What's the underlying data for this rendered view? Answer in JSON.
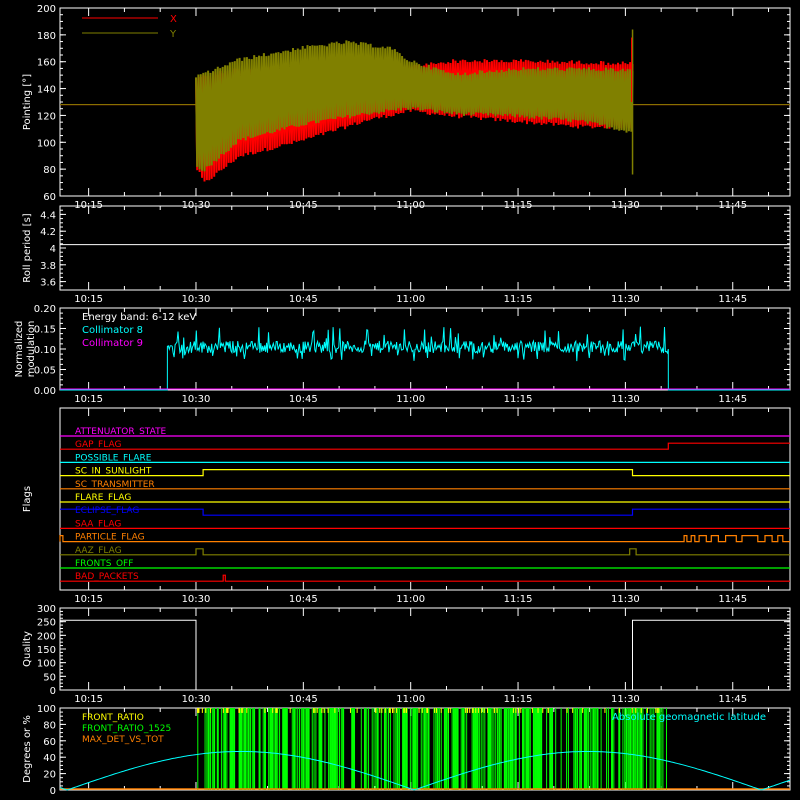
{
  "chart_data": [
    {
      "id": "pointing",
      "type": "line",
      "ylabel": "Pointing [°]",
      "ylim": [
        60,
        200
      ],
      "yticks": [
        60,
        80,
        100,
        120,
        140,
        160,
        180,
        200
      ],
      "xlim": [
        "10:11",
        "11:53"
      ],
      "xticks": [
        "10:15",
        "10:30",
        "10:45",
        "11:00",
        "11:15",
        "11:30",
        "11:45"
      ],
      "legend_position": "top-left",
      "series": [
        {
          "name": "X",
          "color": "#ff0000",
          "baseline": 128,
          "active_range": [
            "10:30",
            "11:31"
          ],
          "upper_envelope": [
            [
              10.5,
              150
            ],
            [
              10.6,
              156
            ],
            [
              10.75,
              158
            ],
            [
              10.9,
              156
            ],
            [
              11.0,
              158
            ],
            [
              11.1,
              162
            ],
            [
              11.25,
              162
            ],
            [
              11.4,
              161
            ],
            [
              11.52,
              160
            ]
          ],
          "lower_envelope": [
            [
              10.5,
              80
            ],
            [
              10.52,
              68
            ],
            [
              10.6,
              88
            ],
            [
              10.75,
              100
            ],
            [
              10.9,
              115
            ],
            [
              11.0,
              122
            ],
            [
              11.1,
              118
            ],
            [
              11.25,
              114
            ],
            [
              11.4,
              110
            ],
            [
              11.52,
              110
            ]
          ]
        },
        {
          "name": "Y",
          "color": "#808000",
          "baseline": 128,
          "active_range": [
            "10:30",
            "11:31"
          ],
          "upper_envelope": [
            [
              10.5,
              150
            ],
            [
              10.6,
              163
            ],
            [
              10.75,
              172
            ],
            [
              10.85,
              176
            ],
            [
              10.95,
              172
            ],
            [
              11.0,
              162
            ],
            [
              11.1,
              152
            ],
            [
              11.25,
              156
            ],
            [
              11.4,
              156
            ],
            [
              11.52,
              155
            ]
          ],
          "lower_envelope": [
            [
              10.5,
              80
            ],
            [
              10.52,
              78
            ],
            [
              10.6,
              100
            ],
            [
              10.75,
              112
            ],
            [
              10.9,
              120
            ],
            [
              11.0,
              124
            ],
            [
              11.1,
              120
            ],
            [
              11.25,
              118
            ],
            [
              11.4,
              114
            ],
            [
              11.52,
              106
            ]
          ]
        }
      ]
    },
    {
      "id": "roll-period",
      "type": "line",
      "ylabel": "Roll period [s]",
      "ylim": [
        3.5,
        4.5
      ],
      "yticks": [
        3.6,
        3.8,
        4.0,
        4.2,
        4.4
      ],
      "xticks": [
        "10:15",
        "10:30",
        "10:45",
        "11:00",
        "11:15",
        "11:30",
        "11:45"
      ],
      "series": [
        {
          "name": "",
          "color": "#ffffff",
          "value": 4.04
        }
      ]
    },
    {
      "id": "modulation",
      "type": "line",
      "ylabel": "Normalized modulation",
      "ylim": [
        0,
        0.2
      ],
      "yticks": [
        "0.00",
        "0.05",
        "0.10",
        "0.15",
        "0.20"
      ],
      "xticks": [
        "10:15",
        "10:30",
        "10:45",
        "11:00",
        "11:15",
        "11:30",
        "11:45"
      ],
      "annotation": "Energy band: 6-12 keV",
      "series": [
        {
          "name": "Collimator 8",
          "color": "#00ffff",
          "active_range": [
            "10:26",
            "11:36"
          ],
          "mean": 0.105,
          "spread": 0.015
        },
        {
          "name": "Collimator 9",
          "color": "#ff00ff",
          "value": 0.0
        }
      ]
    },
    {
      "id": "flags",
      "type": "line",
      "ylabel": "Flags",
      "xticks": [
        "10:15",
        "10:30",
        "10:45",
        "11:00",
        "11:15",
        "11:30",
        "11:45"
      ],
      "flags": [
        {
          "label": "ATTENUATOR_STATE",
          "color": "#ff00ff",
          "transitions": []
        },
        {
          "label": "GAP_FLAG",
          "color": "#ff0000",
          "transitions": [
            [
              "11:36",
              1
            ]
          ]
        },
        {
          "label": "POSSIBLE_FLARE",
          "color": "#00ffff",
          "transitions": []
        },
        {
          "label": "SC_IN_SUNLIGHT",
          "color": "#ffff00",
          "transitions": [
            [
              "10:31",
              1
            ],
            [
              "11:31",
              0
            ]
          ]
        },
        {
          "label": "SC_TRANSMITTER",
          "color": "#ff8000",
          "transitions": []
        },
        {
          "label": "FLARE_FLAG",
          "color": "#ffff00",
          "transitions": []
        },
        {
          "label": "ECLIPSE_FLAG",
          "color": "#0000ff",
          "initial": 1,
          "transitions": [
            [
              "10:31",
              0
            ],
            [
              "11:31",
              1
            ]
          ]
        },
        {
          "label": "SAA_FLAG",
          "color": "#ff0000",
          "transitions": []
        },
        {
          "label": "PARTICLE_FLAG",
          "color": "#ff8000",
          "pulses": [
            [
              "10:11",
              "10:11.4"
            ],
            [
              "11:38.2",
              "11:38.6"
            ],
            [
              "11:39.2",
              "11:39.7"
            ],
            [
              "11:40.3",
              "11:41.3"
            ],
            [
              "11:42",
              "11:43"
            ],
            [
              "11:44",
              "11:45.5"
            ],
            [
              "11:46.3",
              "11:48.5"
            ],
            [
              "11:49.5",
              "11:50.5"
            ],
            [
              "11:51.3",
              "11:52"
            ]
          ]
        },
        {
          "label": "AAZ_FLAG",
          "color": "#808000",
          "pulses": [
            [
              "10:30",
              "10:31"
            ],
            [
              "11:30.6",
              "11:31.5"
            ]
          ]
        },
        {
          "label": "FRONTS_OFF",
          "color": "#00ff00",
          "transitions": []
        },
        {
          "label": "BAD_PACKETS",
          "color": "#ff0000",
          "pulses": [
            [
              "10:33.8",
              "10:34.1"
            ]
          ]
        }
      ]
    },
    {
      "id": "quality",
      "type": "line",
      "ylabel": "Quality",
      "ylim": [
        0,
        300
      ],
      "yticks": [
        0,
        50,
        100,
        150,
        200,
        250,
        300
      ],
      "xticks": [
        "10:15",
        "10:30",
        "10:45",
        "11:00",
        "11:15",
        "11:30",
        "11:45"
      ],
      "series": [
        {
          "name": "",
          "color": "#ffffff",
          "steps": [
            [
              "10:11",
              255
            ],
            [
              "10:30",
              0
            ],
            [
              "11:31",
              255
            ],
            [
              "11:53",
              255
            ]
          ]
        }
      ]
    },
    {
      "id": "front-ratio",
      "type": "line",
      "ylabel": "Degrees or %",
      "ylim": [
        0,
        100
      ],
      "yticks": [
        0,
        20,
        40,
        60,
        80,
        100
      ],
      "series": [
        {
          "name": "FRONT_RATIO",
          "color": "#ffff00"
        },
        {
          "name": "FRONT_RATIO_1525",
          "color": "#00ff00",
          "active_range": [
            "10:30",
            "11:36"
          ]
        },
        {
          "name": "MAX_DET_VS_TOT",
          "color": "#ff8000",
          "value": 0
        }
      ],
      "geomag": {
        "name": "Absolute geomagnetic latitude",
        "color": "#00ffff",
        "zeros": [
          "10:12",
          "11:00.5",
          "11:48.5"
        ],
        "peak": 47
      }
    }
  ]
}
